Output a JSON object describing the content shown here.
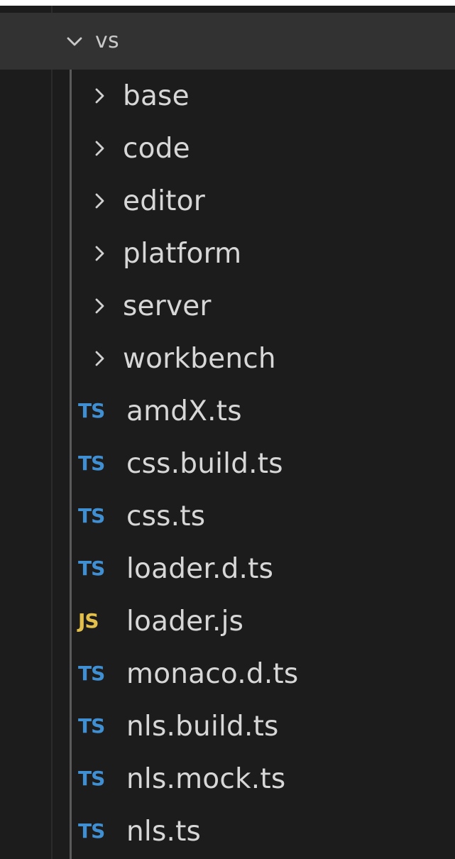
{
  "explorer": {
    "root": {
      "label": "vs",
      "state": "expanded",
      "icon": "chevron-down-icon"
    },
    "items": [
      {
        "type": "folder",
        "label": "base",
        "icon": "chevron-right-icon"
      },
      {
        "type": "folder",
        "label": "code",
        "icon": "chevron-right-icon"
      },
      {
        "type": "folder",
        "label": "editor",
        "icon": "chevron-right-icon"
      },
      {
        "type": "folder",
        "label": "platform",
        "icon": "chevron-right-icon"
      },
      {
        "type": "folder",
        "label": "server",
        "icon": "chevron-right-icon"
      },
      {
        "type": "folder",
        "label": "workbench",
        "icon": "chevron-right-icon"
      },
      {
        "type": "file",
        "label": "amdX.ts",
        "badge": "TS",
        "icon": "typescript-file-icon"
      },
      {
        "type": "file",
        "label": "css.build.ts",
        "badge": "TS",
        "icon": "typescript-file-icon"
      },
      {
        "type": "file",
        "label": "css.ts",
        "badge": "TS",
        "icon": "typescript-file-icon"
      },
      {
        "type": "file",
        "label": "loader.d.ts",
        "badge": "TS",
        "icon": "typescript-file-icon"
      },
      {
        "type": "file",
        "label": "loader.js",
        "badge": "JS",
        "icon": "javascript-file-icon"
      },
      {
        "type": "file",
        "label": "monaco.d.ts",
        "badge": "TS",
        "icon": "typescript-file-icon"
      },
      {
        "type": "file",
        "label": "nls.build.ts",
        "badge": "TS",
        "icon": "typescript-file-icon"
      },
      {
        "type": "file",
        "label": "nls.mock.ts",
        "badge": "TS",
        "icon": "typescript-file-icon"
      },
      {
        "type": "file",
        "label": "nls.ts",
        "badge": "TS",
        "icon": "typescript-file-icon"
      }
    ]
  },
  "colors": {
    "background": "#1c1c1c",
    "selected_row": "#323232",
    "text": "#d7d7d7",
    "ts_badge": "#3f8fd2",
    "js_badge": "#e3c04b"
  }
}
